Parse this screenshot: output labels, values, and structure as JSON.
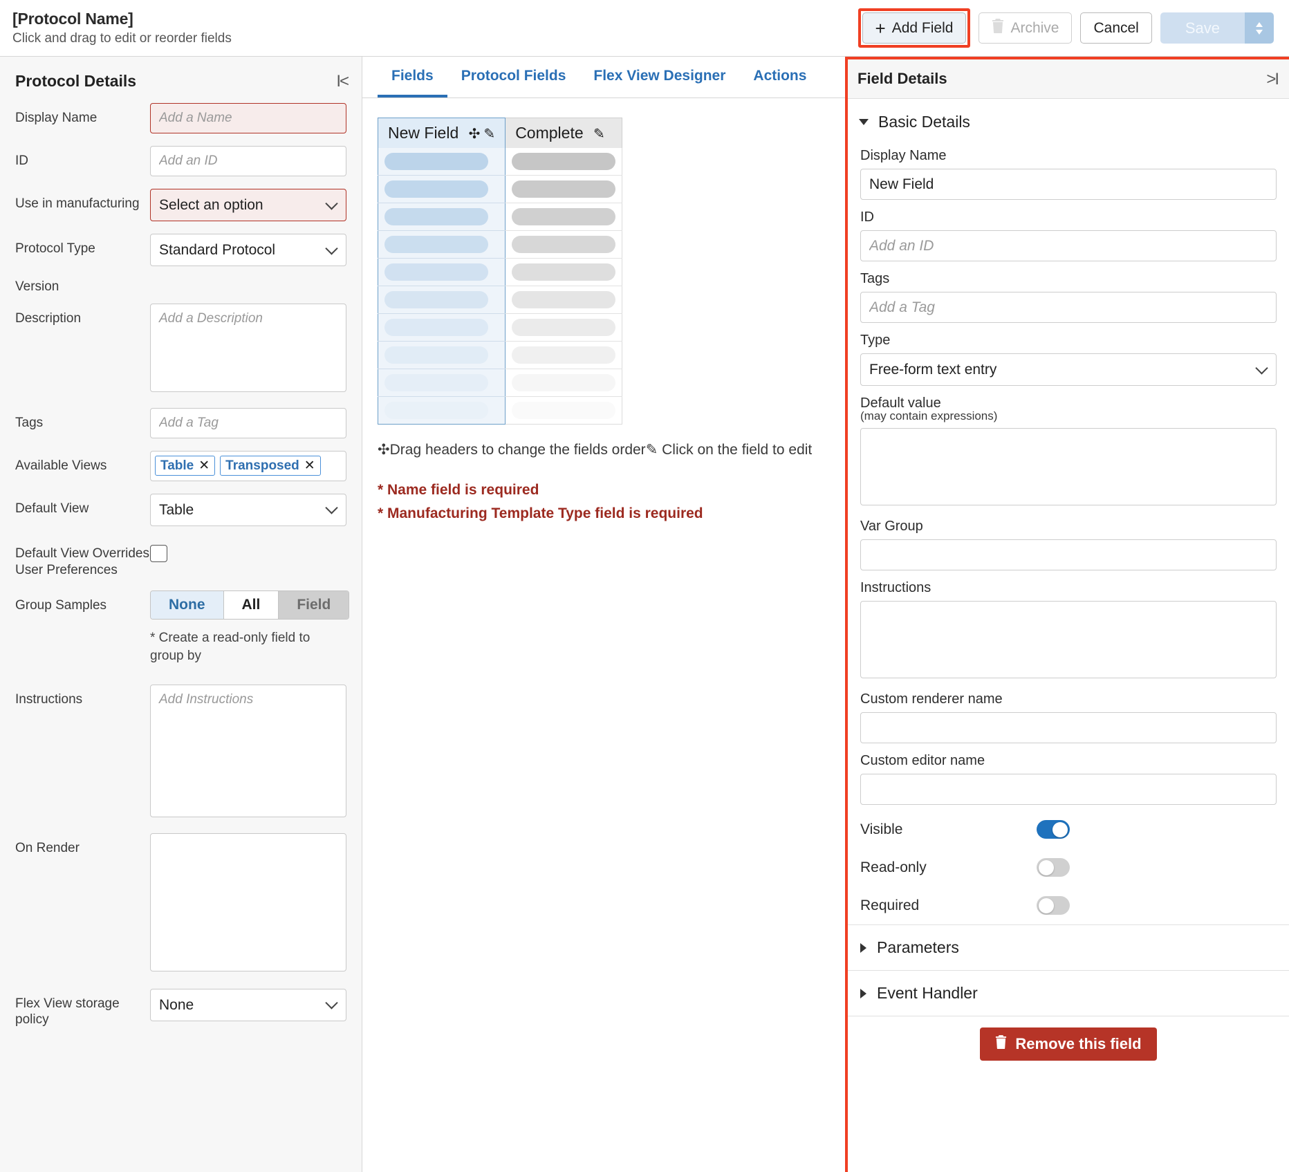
{
  "header": {
    "protocol_title": "[Protocol Name]",
    "subtitle": "Click and drag to edit or reorder fields",
    "add_field_label": "Add Field",
    "add_field_icon": "plus-icon",
    "archive_label": "Archive",
    "archive_icon": "trash-icon",
    "cancel_label": "Cancel",
    "save_label": "Save",
    "save_caret_icon": "caret-updown-icon"
  },
  "left_panel": {
    "title": "Protocol Details",
    "collapse_icon": "collapse-left-icon",
    "fields": {
      "display_name": {
        "label": "Display Name",
        "placeholder": "Add a Name",
        "value": "",
        "required": true
      },
      "id": {
        "label": "ID",
        "placeholder": "Add an ID",
        "value": ""
      },
      "use_in_manufacturing": {
        "label": "Use in manufacturing",
        "value": "Select an option",
        "required": true
      },
      "protocol_type": {
        "label": "Protocol Type",
        "value": "Standard Protocol"
      },
      "version": {
        "label": "Version",
        "value": ""
      },
      "description": {
        "label": "Description",
        "placeholder": "Add a Description",
        "value": ""
      },
      "tags": {
        "label": "Tags",
        "placeholder": "Add a Tag",
        "value": ""
      },
      "available_views": {
        "label": "Available Views",
        "chips": [
          "Table",
          "Transposed"
        ],
        "chip_remove_icon": "close-icon"
      },
      "default_view": {
        "label": "Default View",
        "value": "Table"
      },
      "default_view_overrides": {
        "label": "Default View Overrides User Preferences",
        "checked": false
      },
      "group_samples": {
        "label": "Group Samples",
        "options": [
          "None",
          "All",
          "Field"
        ],
        "selected": "None",
        "disabled": "Field",
        "note": "* Create a read-only field to group by"
      },
      "instructions": {
        "label": "Instructions",
        "placeholder": "Add Instructions",
        "value": ""
      },
      "on_render": {
        "label": "On Render",
        "value": ""
      },
      "flex_view_storage_policy": {
        "label": "Flex View storage policy",
        "value": "None"
      }
    }
  },
  "center_panel": {
    "tabs": [
      {
        "label": "Fields",
        "active": true
      },
      {
        "label": "Protocol Fields",
        "active": false
      },
      {
        "label": "Flex View Designer",
        "active": false
      },
      {
        "label": "Actions",
        "active": false
      }
    ],
    "table": {
      "columns": [
        {
          "label": "New Field",
          "selected": true,
          "icons": [
            "drag-move-icon",
            "pencil-icon"
          ]
        },
        {
          "label": "Complete",
          "selected": false,
          "icons": [
            "pencil-icon"
          ]
        }
      ],
      "row_count": 10
    },
    "drag_hint_drag_icon": "drag-move-icon",
    "drag_hint_1": "Drag headers to change the fields order",
    "drag_hint_pencil_icon": "pencil-icon",
    "drag_hint_2": "Click on the field to edit",
    "errors": [
      "* Name field is required",
      "* Manufacturing Template Type field is required"
    ]
  },
  "right_panel": {
    "title": "Field Details",
    "collapse_icon": "collapse-right-icon",
    "basic_details": {
      "section_label": "Basic Details",
      "expanded": true,
      "display_name": {
        "label": "Display Name",
        "value": "New Field"
      },
      "id": {
        "label": "ID",
        "placeholder": "Add an ID",
        "value": ""
      },
      "tags": {
        "label": "Tags",
        "placeholder": "Add a Tag",
        "value": ""
      },
      "type": {
        "label": "Type",
        "value": "Free-form text entry"
      },
      "default_value": {
        "label": "Default value",
        "sublabel": "(may contain expressions)",
        "value": ""
      },
      "var_group": {
        "label": "Var Group",
        "value": ""
      },
      "instructions": {
        "label": "Instructions",
        "value": ""
      },
      "custom_renderer_name": {
        "label": "Custom renderer name",
        "value": ""
      },
      "custom_editor_name": {
        "label": "Custom editor name",
        "value": ""
      },
      "toggles": [
        {
          "label": "Visible",
          "on": true
        },
        {
          "label": "Read-only",
          "on": false
        },
        {
          "label": "Required",
          "on": false
        }
      ]
    },
    "parameters": {
      "label": "Parameters",
      "expanded": false
    },
    "event_handler": {
      "label": "Event Handler",
      "expanded": false
    },
    "remove_button": {
      "label": "Remove this field",
      "icon": "trash-icon"
    }
  },
  "colors": {
    "accent_red": "#f03f23",
    "link_blue": "#2a6fb5",
    "error_red": "#9c2a20",
    "toggle_on": "#1f72bd",
    "remove_bg": "#b63427"
  }
}
